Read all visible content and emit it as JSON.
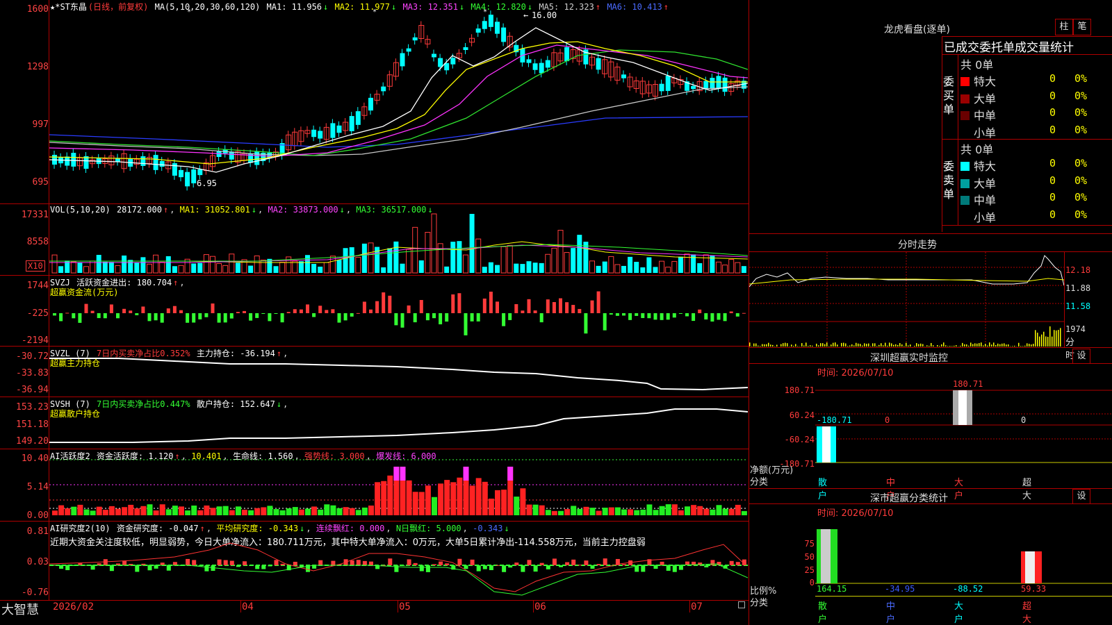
{
  "stock": {
    "name": "★*ST东晶",
    "period": "(日线，前复权)",
    "star": "★"
  },
  "ma": {
    "head": "MA(5,10,20,30,60,120)",
    "ma1": "MA1: 11.956",
    "ma2": "MA2: 11.977",
    "ma3": "MA3: 12.351",
    "ma4": "MA4: 12.820",
    "ma5": "MA5: 12.323",
    "ma6": "MA6: 10.413",
    "arrow_down": "↓",
    "arrow_up": "↑",
    "high_mark": "16.00",
    "low_mark": "6.95"
  },
  "price_axis": [
    "1600",
    "1298",
    "997",
    "695"
  ],
  "vol": {
    "head": "VOL(5,10,20)",
    "val": "28172.000",
    "ma1": "MA1: 31052.801",
    "ma2": "MA2: 33873.000",
    "ma3": "MA3: 36517.000",
    "axis": [
      "17331",
      "8558"
    ],
    "unit": "X10"
  },
  "svzj": {
    "head": "SVZJ",
    "t1": "活跃资金进出: 180.704",
    "t2": "超赢资金流(万元)",
    "axis": [
      "1744",
      "-225",
      "-2194"
    ]
  },
  "svzl": {
    "head": "SVZL (7)",
    "t1": "7日内买卖净占比0.352%",
    "t2": "主力持仓: -36.194",
    "t3": "超赢主力持仓",
    "axis": [
      "-30.72",
      "-33.83",
      "-36.94"
    ]
  },
  "svsh": {
    "head": "SVSH (7)",
    "t1": "7日内买卖净占比0.447%",
    "t2": "散户持仓: 152.647",
    "t3": "超赢散户持仓",
    "axis": [
      "153.23",
      "151.18",
      "149.20"
    ]
  },
  "ai1": {
    "head": "AI活跃度2",
    "t1": "资金活跃度: 1.120",
    "t2": "10.401",
    "t3": "生命线: 1.560",
    "t4": "强势线: 3.000",
    "t5": "爆发线: 6.000",
    "axis": [
      "10.40",
      "5.14",
      "0.00"
    ]
  },
  "ai2": {
    "head": "AI研究度2(10)",
    "t1": "资金研究度: -0.047",
    "t2": "平均研究度: -0.343",
    "t3": "连续飘红: 0.000",
    "t4": "N日飘红: 5.000",
    "t5": "-0.343",
    "note": "近期大资金关注度较低，明显弱势，今日大单净流入：180.711万元，其中特大单净流入：0万元，大单5日累计净出-114.558万元，当前主力控盘弱",
    "axis": [
      "0.81",
      "0.03",
      "-0.76"
    ]
  },
  "xaxis": {
    "brand": "大智慧",
    "labels": [
      "2026/02",
      "04",
      "05",
      "06",
      "07"
    ]
  },
  "dragon": {
    "title": "龙虎看盘(逐单)",
    "btn1": "柱",
    "btn2": "笔",
    "subtitle": "已成交委托单成交量统计",
    "buy_label": "委买单",
    "sell_label": "委卖单",
    "buy_total": "共 0单",
    "sell_total": "共 0单",
    "buy_rows": [
      {
        "name": "特大",
        "v": "0",
        "p": "0%",
        "color": "#ff0000"
      },
      {
        "name": "大单",
        "v": "0",
        "p": "0%",
        "color": "#990000"
      },
      {
        "name": "中单",
        "v": "0",
        "p": "0%",
        "color": "#6a0000"
      },
      {
        "name": "小单",
        "v": "0",
        "p": "0%",
        "color": ""
      }
    ],
    "sell_rows": [
      {
        "name": "特大",
        "v": "0",
        "p": "0%",
        "color": "#00ffff"
      },
      {
        "name": "大单",
        "v": "0",
        "p": "0%",
        "color": "#00a0a0"
      },
      {
        "name": "中单",
        "v": "0",
        "p": "0%",
        "color": "#007a7a"
      },
      {
        "name": "小单",
        "v": "0",
        "p": "0%",
        "color": ""
      }
    ]
  },
  "intraday": {
    "title": "分时走势",
    "axis": [
      "12.18",
      "11.88",
      "11.58",
      "1974"
    ],
    "unit": "分时"
  },
  "monitor": {
    "title": "深圳超赢实时监控",
    "btn": "设",
    "time": "时间: 2026/07/10",
    "axis": [
      "180.71",
      "60.24",
      "-60.24",
      "-180.71"
    ],
    "ylabel": "净额(万元)",
    "xlabel": "分类",
    "cats": [
      "散户",
      "中户",
      "大户",
      "超大"
    ],
    "vals": [
      "-180.71",
      "0",
      "180.71",
      "0"
    ]
  },
  "classify": {
    "title": "深市超赢分类统计",
    "btn": "设",
    "time": "时间: 2026/07/10",
    "axis": [
      "75",
      "50",
      "25",
      "0"
    ],
    "ylabel": "比例%",
    "xlabel": "分类",
    "cats": [
      "散户",
      "中户",
      "大户",
      "超大"
    ],
    "vals": [
      "164.15",
      "-34.95",
      "-88.52",
      "59.33"
    ]
  }
}
